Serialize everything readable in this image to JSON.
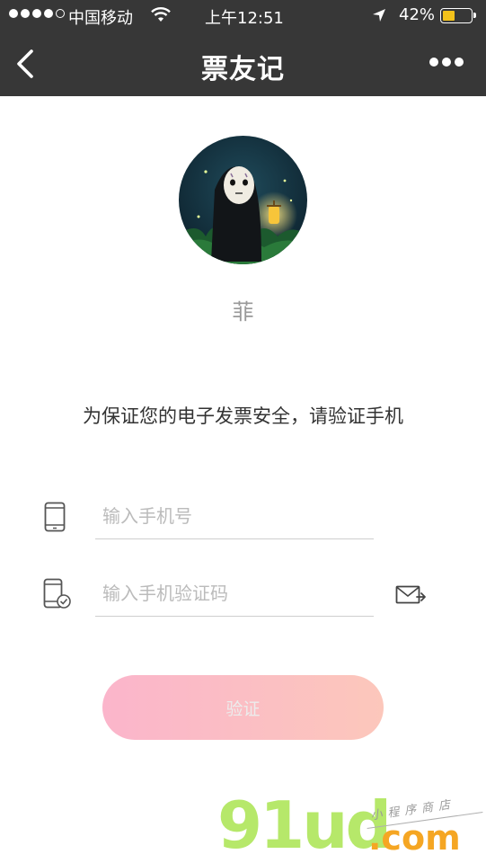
{
  "status_bar": {
    "carrier": "中国移动",
    "time": "上午12:51",
    "battery_percent": "42%",
    "battery_level": 0.42,
    "signal_bars": 4,
    "signal_total": 5
  },
  "nav": {
    "title": "票友记",
    "back_icon": "chevron-left-icon",
    "more_icon": "more-dots-icon"
  },
  "profile": {
    "name": "菲"
  },
  "notice": "为保证您的电子发票安全，请验证手机",
  "form": {
    "phone_placeholder": "输入手机号",
    "phone_value": "",
    "code_placeholder": "输入手机验证码",
    "code_value": "",
    "phone_icon": "phone-icon",
    "code_icon": "phone-check-icon",
    "send_code_icon": "send-mail-icon",
    "submit_label": "验证"
  },
  "watermark": {
    "main": "91ud",
    "suffix": ".com",
    "subtitle": "小程序商店"
  },
  "colors": {
    "nav_bg": "#373737",
    "button_gradient_start": "#fbb5cb",
    "button_gradient_end": "#fcc7bb",
    "battery": "#f3c21b"
  }
}
